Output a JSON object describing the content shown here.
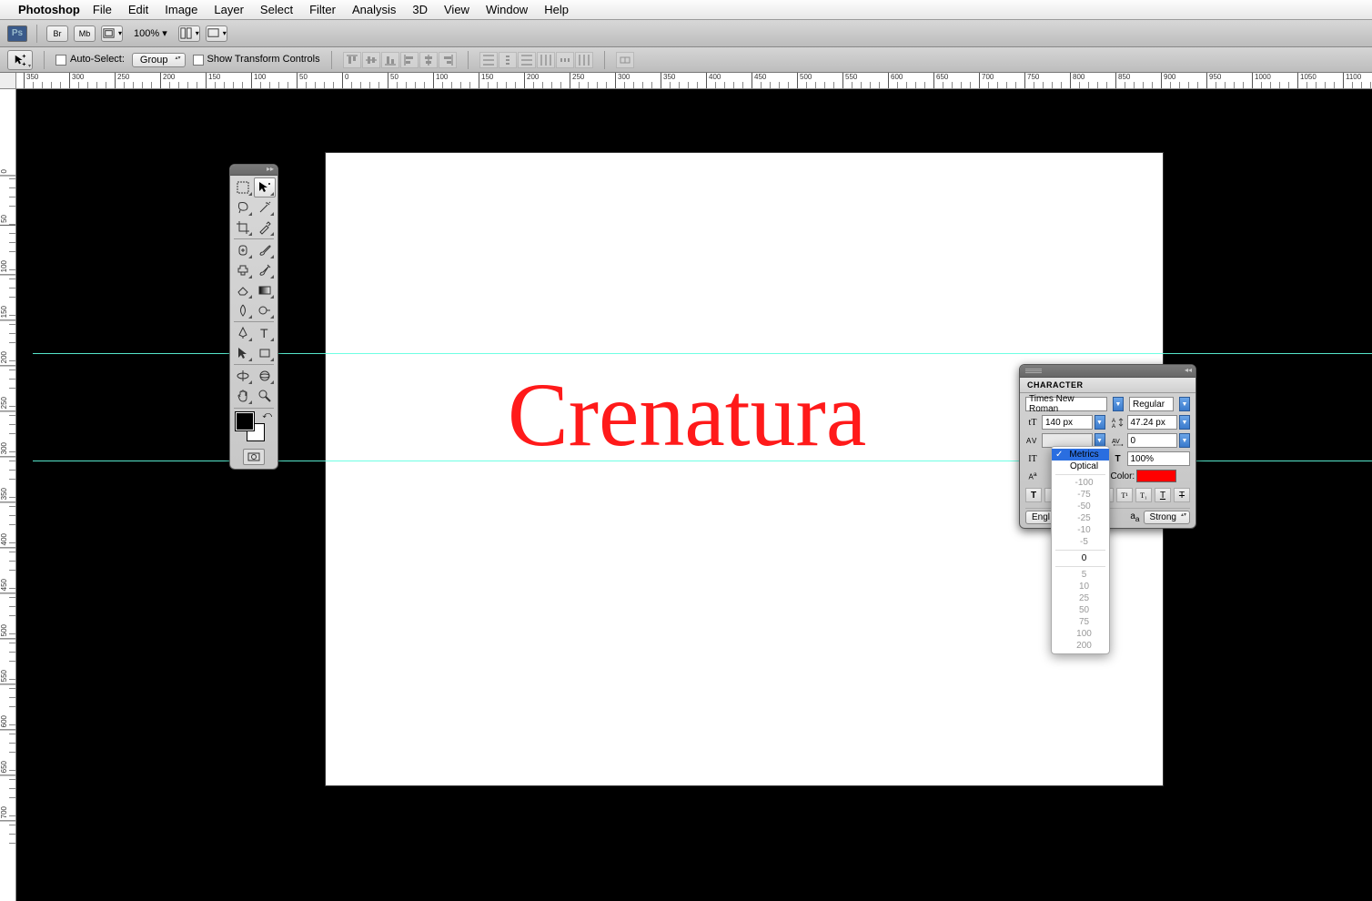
{
  "menubar": {
    "app": "Photoshop",
    "items": [
      "File",
      "Edit",
      "Image",
      "Layer",
      "Select",
      "Filter",
      "Analysis",
      "3D",
      "View",
      "Window",
      "Help"
    ]
  },
  "appbar": {
    "br": "Br",
    "mb": "Mb",
    "zoom": "100% ▾"
  },
  "optbar": {
    "autoselect_label": "Auto-Select:",
    "group": "Group",
    "transform_label": "Show Transform Controls"
  },
  "ruler_h": [
    -350,
    -300,
    -250,
    -200,
    -150,
    -100,
    -50,
    0,
    50,
    100,
    150,
    200,
    250,
    300,
    350,
    400,
    450,
    500,
    550,
    600,
    650,
    700,
    750,
    800,
    850,
    900,
    950,
    1000,
    1050,
    1100
  ],
  "ruler_v": [
    0,
    50,
    100,
    150,
    200,
    250,
    300,
    350,
    400,
    450,
    500,
    550,
    600,
    650,
    700
  ],
  "canvas": {
    "text": "Crenatura"
  },
  "char": {
    "title": "CHARACTER",
    "font": "Times New Roman",
    "style": "Regular",
    "size": "140 px",
    "leading": "47.24 px",
    "tracking": "0",
    "vscale": "100%",
    "color_label": "Color:",
    "lang": "Engl",
    "aa": "Strong"
  },
  "kern": {
    "opts_top": [
      "Metrics",
      "Optical"
    ],
    "opts_neg": [
      "-100",
      "-75",
      "-50",
      "-25",
      "-10",
      "-5"
    ],
    "zero": "0",
    "opts_pos": [
      "5",
      "10",
      "25",
      "50",
      "75",
      "100",
      "200"
    ]
  }
}
